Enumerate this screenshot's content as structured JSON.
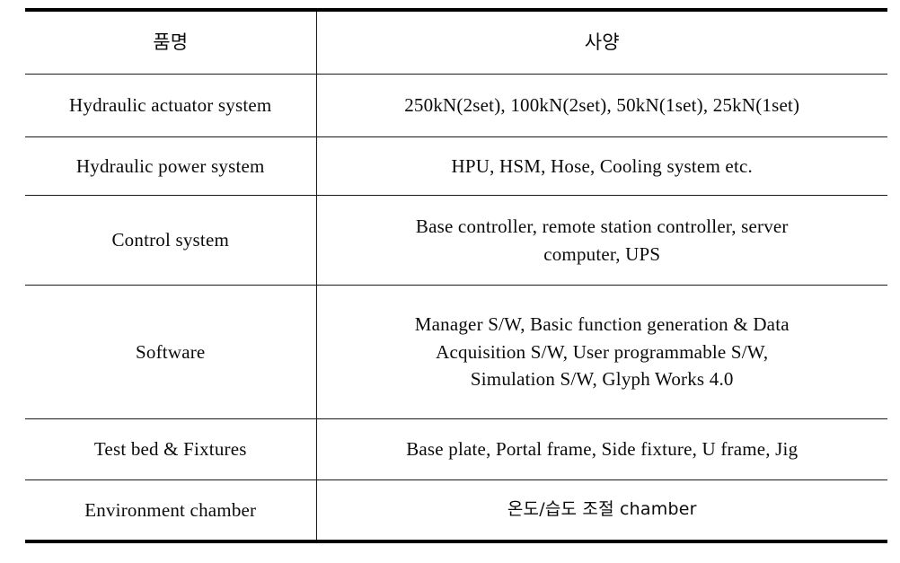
{
  "table": {
    "headers": {
      "item": "품명",
      "spec": "사양"
    },
    "rows": [
      {
        "item": "Hydraulic actuator system",
        "spec_lines": [
          "250kN(2set), 100kN(2set), 50kN(1set), 25kN(1set)"
        ]
      },
      {
        "item": "Hydraulic power system",
        "spec_lines": [
          "HPU, HSM, Hose, Cooling system etc."
        ]
      },
      {
        "item": "Control system",
        "spec_lines": [
          "Base controller, remote station controller, server",
          "computer, UPS"
        ]
      },
      {
        "item": "Software",
        "spec_lines": [
          "Manager S/W, Basic function generation & Data",
          "Acquisition S/W, User programmable S/W,",
          "Simulation S/W, Glyph Works 4.0"
        ]
      },
      {
        "item": "Test bed & Fixtures",
        "spec_lines": [
          "Base plate, Portal frame, Side fixture, U frame, Jig"
        ]
      },
      {
        "item": "Environment chamber",
        "spec_lines": [
          "온도/습도 조절 chamber"
        ]
      }
    ]
  },
  "colors": {
    "background": "#ffffff",
    "text": "#0b0b0b",
    "rule": "#1a1a1a",
    "heavy_rule": "#000000"
  }
}
